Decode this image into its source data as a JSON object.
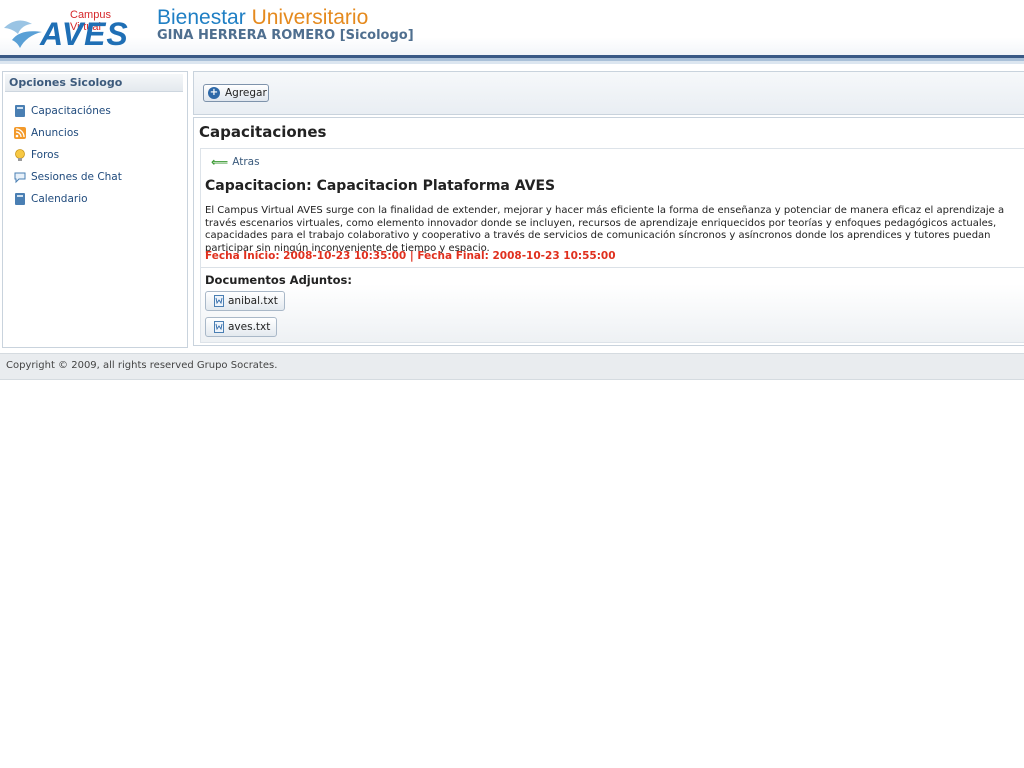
{
  "header": {
    "logo_small": "Campus Virtual",
    "logo_big": "AVES",
    "title_part1": "Bienestar",
    "title_part2": "Universitario",
    "user": "GINA HERRERA ROMERO [Sicologo]"
  },
  "sidebar": {
    "title": "Opciones Sicologo",
    "items": [
      {
        "label": "Capacitaciónes",
        "icon": "book-icon"
      },
      {
        "label": "Anuncios",
        "icon": "rss-icon"
      },
      {
        "label": "Foros",
        "icon": "lightbulb-icon"
      },
      {
        "label": "Sesiones de Chat",
        "icon": "chat-bubble-icon"
      },
      {
        "label": "Calendario",
        "icon": "book-icon"
      }
    ]
  },
  "toolbar": {
    "add_label": "Agregar"
  },
  "main": {
    "section_title": "Capacitaciones",
    "back_label": "Atras",
    "training_title": "Capacitacion: Capacitacion Plataforma AVES",
    "description": "El Campus Virtual AVES surge con la finalidad de extender, mejorar y hacer más eficiente la forma de enseñanza y potenciar de manera eficaz el aprendizaje a través escenarios virtuales, como elemento innovador donde se incluyen, recursos de aprendizaje enriquecidos por teorías y enfoques pedagógicos actuales, capacidades para el trabajo colaborativo y cooperativo a través de servicios de comunicación síncronos y asíncronos donde los aprendices y tutores puedan participar sin ningún inconveniente de tiempo y espacio.",
    "dates": "Fecha Inicio: 2008-10-23 10:35:00 | Fecha Final: 2008-10-23 10:55:00",
    "docs_label": "Documentos Adjuntos:",
    "documents": [
      "anibal.txt",
      "aves.txt"
    ]
  },
  "footer": {
    "copyright": "Copyright © 2009, all rights reserved Grupo Socrates."
  },
  "colors": {
    "header_blue": "#1f7fc4",
    "header_orange": "#e58a1e",
    "date_red": "#e0301e",
    "logo_red": "#d6282b"
  }
}
